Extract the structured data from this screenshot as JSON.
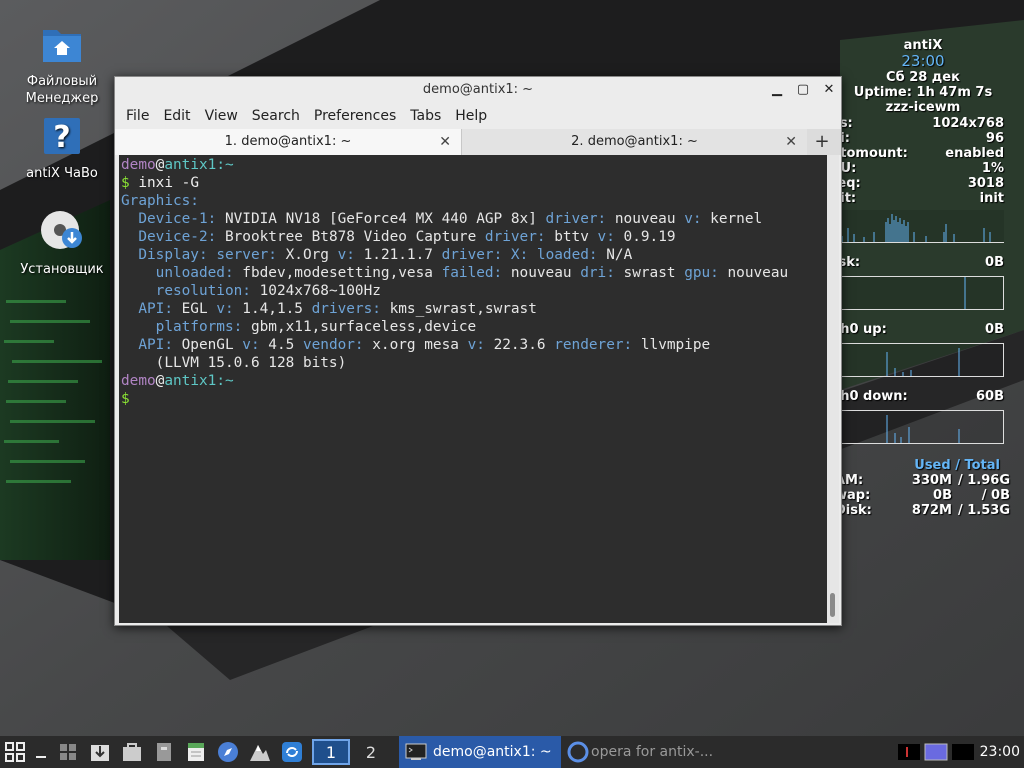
{
  "desktop": {
    "icons": [
      {
        "label": "Файловый Менеджер",
        "icon": "folder-home-icon"
      },
      {
        "label": "antiX ЧаВо",
        "icon": "help-icon"
      },
      {
        "label": "Установщик",
        "icon": "installer-disc-icon"
      }
    ]
  },
  "conky": {
    "host": "antiX",
    "time": "23:00",
    "date": "Сб 28 дек",
    "uptime": "Uptime: 1h 47m 7s",
    "wm": "zzz-icewm",
    "stats": [
      {
        "key": "es:",
        "value": "1024x768"
      },
      {
        "key": "pi:",
        "value": "96"
      },
      {
        "key": "utomount:",
        "value": "enabled"
      },
      {
        "key": "PU:",
        "value": "1%"
      },
      {
        "key": "req:",
        "value": "3018"
      },
      {
        "key": "nit:",
        "value": "init"
      }
    ],
    "graphs": [
      {
        "key": "isk:",
        "value": "0B"
      },
      {
        "key": "th0 up:",
        "value": "0B"
      },
      {
        "key": "th0 down:",
        "value": "60B"
      }
    ],
    "mem_header": "Used / Total",
    "mem": [
      {
        "key": "AM:",
        "used": "330M",
        "total": "/ 1.96G"
      },
      {
        "key": "wap:",
        "used": "0B",
        "total": "/ 0B"
      },
      {
        "key": "Disk:",
        "used": "872M",
        "total": "/ 1.53G"
      }
    ]
  },
  "window": {
    "title": "demo@antix1: ~",
    "controls": {
      "minimize": "▁",
      "maximize": "▢",
      "close": "✕"
    },
    "menu": [
      "File",
      "Edit",
      "View",
      "Search",
      "Preferences",
      "Tabs",
      "Help"
    ],
    "tabs": [
      {
        "label": "1. demo@antix1: ~",
        "active": true
      },
      {
        "label": "2. demo@antix1: ~",
        "active": false
      }
    ],
    "tab_add": "+",
    "tab_close": "✕"
  },
  "terminal": {
    "user": "demo",
    "at": "@",
    "host": "antix1",
    "path": ":~",
    "dollar": "$",
    "command": " inxi -G",
    "output": [
      [
        {
          "t": "Graphics:",
          "c": "lab"
        }
      ],
      [
        {
          "t": "  Device-1:",
          "c": "lab"
        },
        {
          "t": " NVIDIA NV18 [GeForce4 MX 440 AGP 8x] ",
          "c": "val"
        },
        {
          "t": "driver:",
          "c": "lab"
        },
        {
          "t": " nouveau ",
          "c": "val"
        },
        {
          "t": "v:",
          "c": "lab"
        },
        {
          "t": " kernel",
          "c": "val"
        }
      ],
      [
        {
          "t": "  Device-2:",
          "c": "lab"
        },
        {
          "t": " Brooktree Bt878 Video Capture ",
          "c": "val"
        },
        {
          "t": "driver:",
          "c": "lab"
        },
        {
          "t": " bttv ",
          "c": "val"
        },
        {
          "t": "v:",
          "c": "lab"
        },
        {
          "t": " 0.9.19",
          "c": "val"
        }
      ],
      [
        {
          "t": "  Display:",
          "c": "lab"
        },
        {
          "t": " ",
          "c": "val"
        },
        {
          "t": "server:",
          "c": "lab"
        },
        {
          "t": " X.Org ",
          "c": "val"
        },
        {
          "t": "v:",
          "c": "lab"
        },
        {
          "t": " 1.21.1.7 ",
          "c": "val"
        },
        {
          "t": "driver:",
          "c": "lab"
        },
        {
          "t": " ",
          "c": "val"
        },
        {
          "t": "X:",
          "c": "lab"
        },
        {
          "t": " ",
          "c": "val"
        },
        {
          "t": "loaded:",
          "c": "lab"
        },
        {
          "t": " N/A",
          "c": "val"
        }
      ],
      [
        {
          "t": "    unloaded:",
          "c": "lab"
        },
        {
          "t": " fbdev,modesetting,vesa ",
          "c": "val"
        },
        {
          "t": "failed:",
          "c": "lab"
        },
        {
          "t": " nouveau ",
          "c": "val"
        },
        {
          "t": "dri:",
          "c": "lab"
        },
        {
          "t": " swrast ",
          "c": "val"
        },
        {
          "t": "gpu:",
          "c": "lab"
        },
        {
          "t": " nouveau",
          "c": "val"
        }
      ],
      [
        {
          "t": "    resolution:",
          "c": "lab"
        },
        {
          "t": " 1024x768~100Hz",
          "c": "val"
        }
      ],
      [
        {
          "t": "  API:",
          "c": "lab"
        },
        {
          "t": " EGL ",
          "c": "val"
        },
        {
          "t": "v:",
          "c": "lab"
        },
        {
          "t": " 1.4,1.5 ",
          "c": "val"
        },
        {
          "t": "drivers:",
          "c": "lab"
        },
        {
          "t": " kms_swrast,swrast",
          "c": "val"
        }
      ],
      [
        {
          "t": "    platforms:",
          "c": "lab"
        },
        {
          "t": " gbm,x11,surfaceless,device",
          "c": "val"
        }
      ],
      [
        {
          "t": "  API:",
          "c": "lab"
        },
        {
          "t": " OpenGL ",
          "c": "val"
        },
        {
          "t": "v:",
          "c": "lab"
        },
        {
          "t": " 4.5 ",
          "c": "val"
        },
        {
          "t": "vendor:",
          "c": "lab"
        },
        {
          "t": " x.org mesa ",
          "c": "val"
        },
        {
          "t": "v:",
          "c": "lab"
        },
        {
          "t": " 22.3.6 ",
          "c": "val"
        },
        {
          "t": "renderer:",
          "c": "lab"
        },
        {
          "t": " llvmpipe",
          "c": "val"
        }
      ],
      [
        {
          "t": "    (LLVM 15.0.6 128 bits)",
          "c": "val"
        }
      ]
    ]
  },
  "taskbar": {
    "workspaces": [
      "1",
      "2"
    ],
    "active_workspace": "1",
    "tasks": [
      {
        "label": "demo@antix1: ~",
        "active": true,
        "icon": "terminal-icon"
      },
      {
        "label": "opera for antix-...",
        "active": false,
        "icon": "opera-icon"
      }
    ],
    "clock": "23:00"
  },
  "colors": {
    "prompt_user": "#b184c4",
    "prompt_host": "#5ec7c5",
    "prompt_dollar": "#8ae234",
    "label": "#6ea3d6",
    "conky_accent": "#64b5f6",
    "taskbar_active": "#2a5aa8"
  }
}
